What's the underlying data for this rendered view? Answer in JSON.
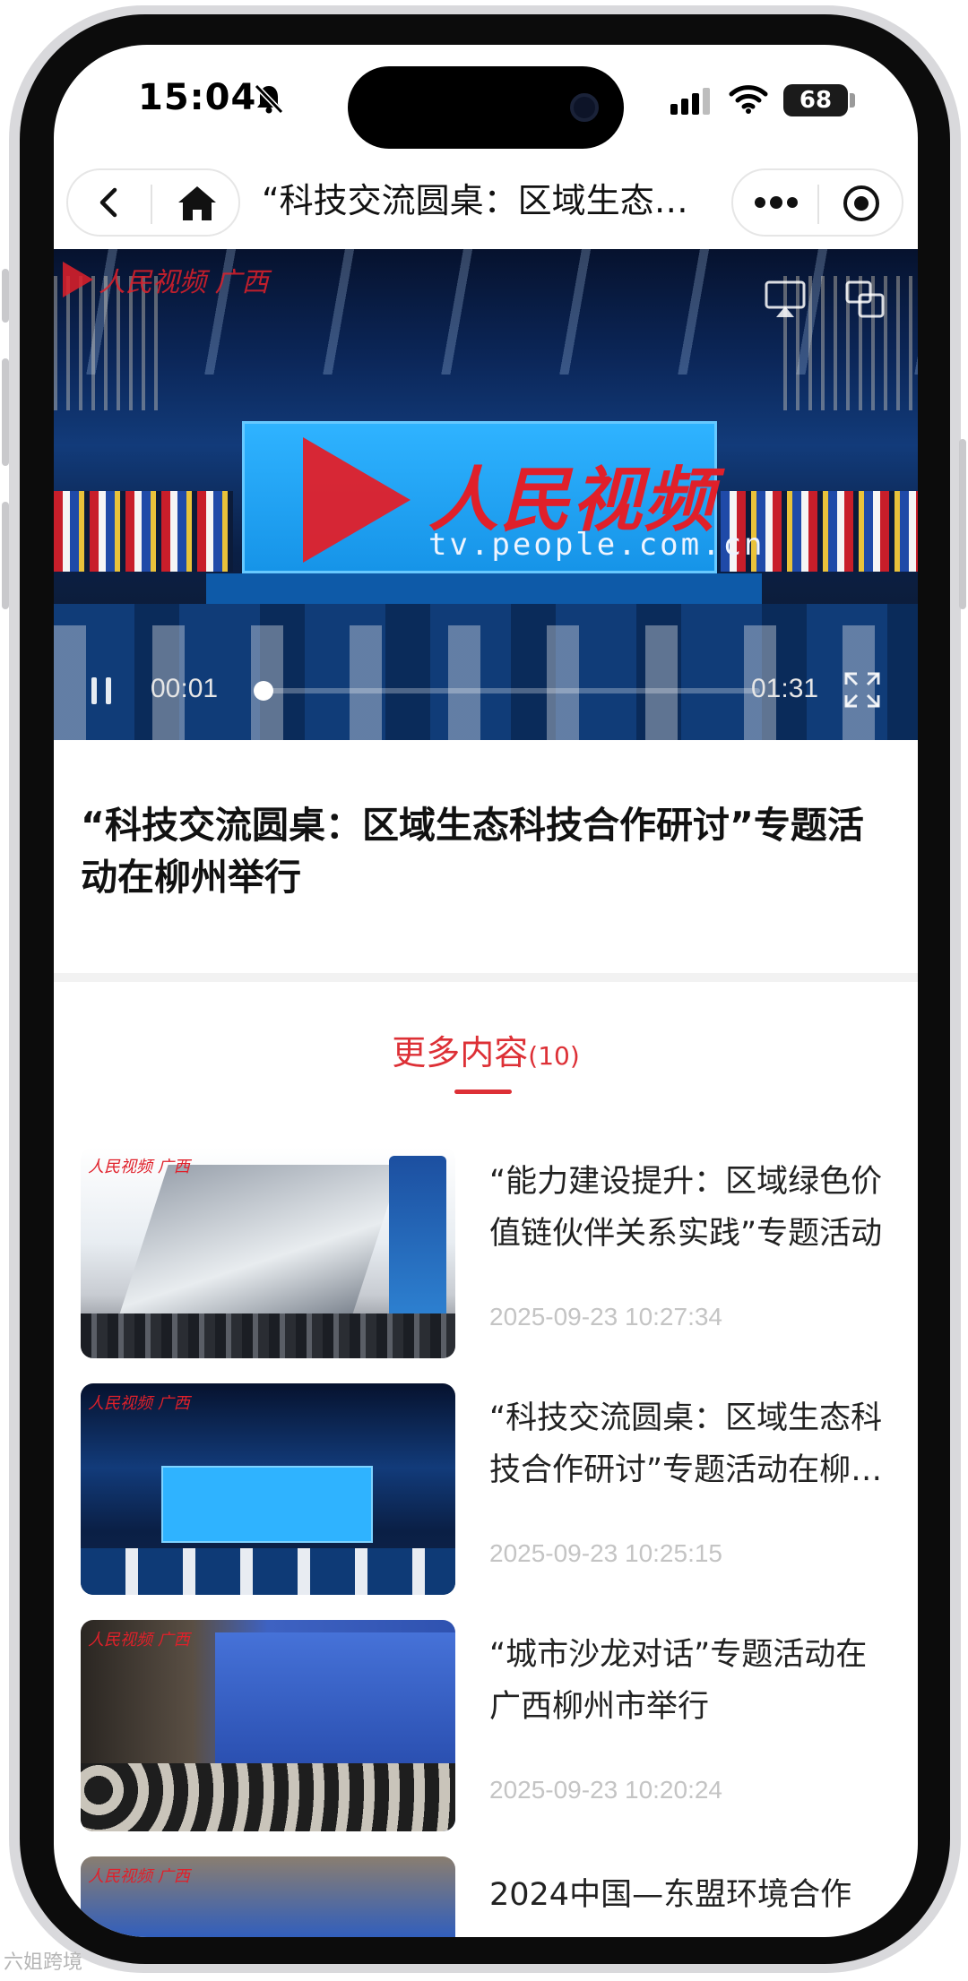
{
  "status_bar": {
    "time": "15:04",
    "battery": "68"
  },
  "navbar": {
    "title": "“科技交流圆桌：区域生态…"
  },
  "video": {
    "watermark_small": "人民视频 广西",
    "watermark_brand": "人民视频",
    "watermark_url": "tv.people.com.cn",
    "current_time": "00:01",
    "total_time": "01:31",
    "progress": 0.01
  },
  "article": {
    "title": "“科技交流圆桌：区域生态科技合作研讨”专题活动在柳州举行"
  },
  "more": {
    "label": "更多内容",
    "count": "(10)"
  },
  "items": [
    {
      "title": "“能力建设提升：区域绿色价值链伙伴关系实践”专题活动",
      "time": "2025-09-23 10:27:34",
      "thumb_label": "人民视频 广西"
    },
    {
      "title": "“科技交流圆桌：区域生态科技合作研讨”专题活动在柳州举行",
      "time": "2025-09-23 10:25:15",
      "thumb_label": "人民视频 广西"
    },
    {
      "title": "“城市沙龙对话”专题活动在广西柳州市举行",
      "time": "2025-09-23 10:20:24",
      "thumb_label": "人民视频 广西"
    },
    {
      "title": "2024中国—东盟环境合作",
      "time": "",
      "thumb_label": "人民视频 广西"
    }
  ],
  "bottom_watermark": "六姐跨境",
  "colors": {
    "accent": "#dd3036",
    "brand_red": "#e0202a"
  }
}
